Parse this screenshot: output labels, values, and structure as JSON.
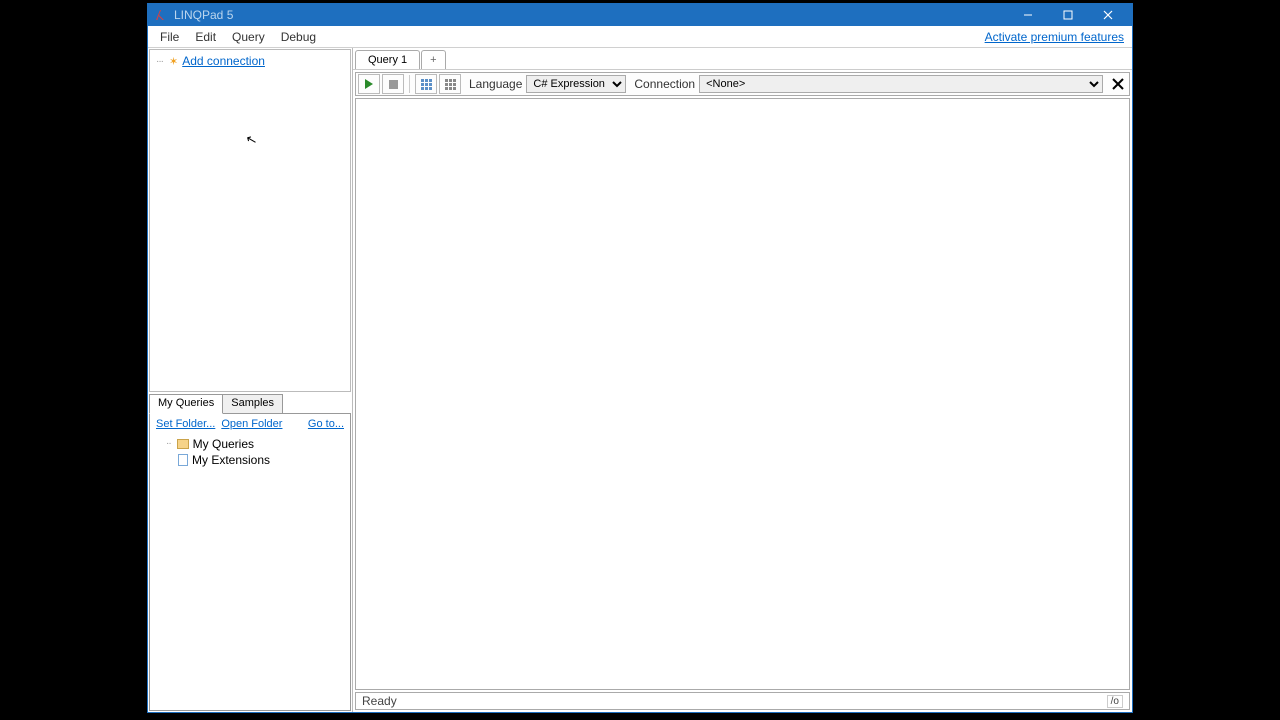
{
  "window": {
    "title": "LINQPad 5"
  },
  "menu": {
    "file": "File",
    "edit": "Edit",
    "query": "Query",
    "debug": "Debug"
  },
  "premium_link": "Activate premium features",
  "sidebar": {
    "add_connection": "Add connection",
    "tabs": {
      "my_queries": "My Queries",
      "samples": "Samples"
    },
    "links": {
      "set_folder": "Set Folder...",
      "open_folder": "Open Folder",
      "go_to": "Go to..."
    },
    "tree": {
      "my_queries": "My Queries",
      "my_extensions": "My Extensions"
    }
  },
  "query_tabs": {
    "tab1": "Query 1",
    "plus": "+"
  },
  "toolbar": {
    "language_label": "Language",
    "language_value": "C# Expression",
    "connection_label": "Connection",
    "connection_value": "<None>"
  },
  "status": {
    "ready": "Ready",
    "right": "/o"
  }
}
